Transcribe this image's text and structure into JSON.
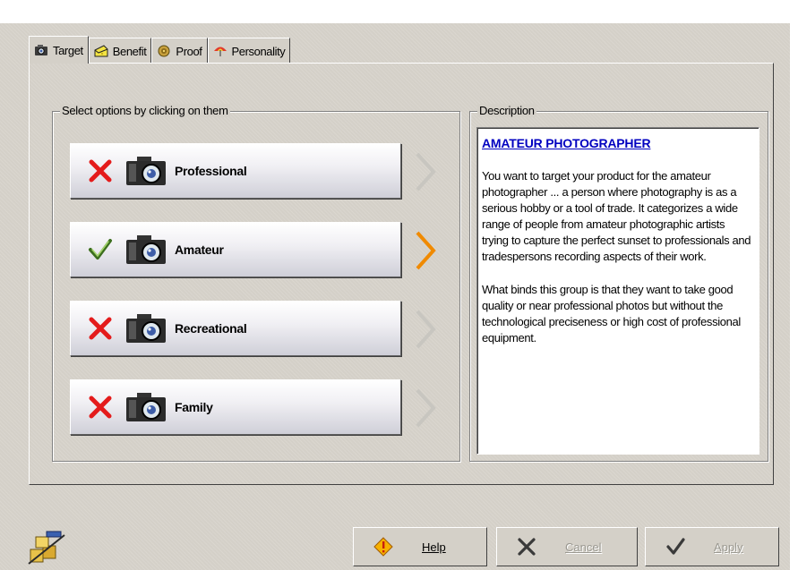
{
  "tabs": [
    {
      "label": "Target",
      "icon": "camera-icon",
      "active": true
    },
    {
      "label": "Benefit",
      "icon": "cheese-icon",
      "active": false
    },
    {
      "label": "Proof",
      "icon": "flower-icon",
      "active": false
    },
    {
      "label": "Personality",
      "icon": "umbrella-icon",
      "active": false
    }
  ],
  "options_group": {
    "label": "Select options by clicking on them",
    "options": [
      {
        "label": "Professional",
        "mark": "cross-icon",
        "selected": false
      },
      {
        "label": "Amateur",
        "mark": "check-icon",
        "selected": true
      },
      {
        "label": "Recreational",
        "mark": "cross-icon",
        "selected": false
      },
      {
        "label": "Family",
        "mark": "cross-icon",
        "selected": false
      }
    ]
  },
  "description": {
    "label": "Description",
    "title": "AMATEUR PHOTOGRAPHER",
    "paragraphs": [
      "You want to target your product for the amateur photographer ... a person where photography is as a serious hobby or a tool of trade. It categorizes a wide range of people from amateur photographic artists trying to capture the perfect sunset to professionals and tradespersons recording aspects of their work.",
      "What binds this group is that they want to take good quality or near professional photos but without the technological preciseness or high cost of professional equipment."
    ]
  },
  "buttons": {
    "help": "Help",
    "cancel": "Cancel",
    "apply": "Apply"
  },
  "colors": {
    "cross": "#e41b1b",
    "check": "#3c6e1e",
    "chevron_active": "#f08a00",
    "chevron_inactive": "#c8c6c0",
    "title_link": "#0000c0"
  }
}
